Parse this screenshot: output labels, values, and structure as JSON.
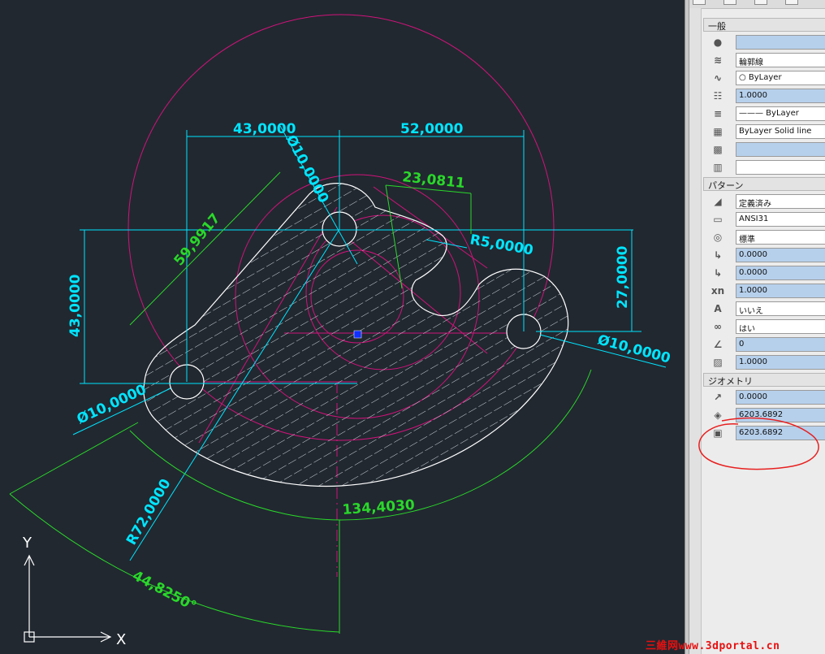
{
  "drawing": {
    "dims": {
      "dim_43_horiz": "43,0000",
      "dim_52_horiz": "52,0000",
      "dim_dia_top": "Ø10,0000",
      "dim_23": "23,0811",
      "dim_59": "59,9917",
      "dim_r5": "R5,0000",
      "dim_27": "27,0000",
      "dim_43_vert": "43,0000",
      "dim_dia_right": "Ø10,0000",
      "dim_dia_left": "Ø10,0000",
      "dim_r72": "R72,0000",
      "dim_134": "134,4030",
      "dim_angle": "44,8250°"
    },
    "ucs": {
      "y_label": "Y",
      "x_label": "X"
    },
    "colors": {
      "background": "#212830",
      "dimension": "#00e5ff",
      "dimension_green": "#2ad82a",
      "construction": "#d0137a",
      "outline": "#ffffff",
      "grip": "#1030ff"
    }
  },
  "panel": {
    "sections": {
      "general": "一般",
      "pattern": "パターン",
      "geometry": "ジオメトリ"
    },
    "general_rows": [
      {
        "icon": "color-icon",
        "value": "",
        "style": "blue"
      },
      {
        "icon": "layer-icon",
        "value": "輪郭線",
        "style": "white"
      },
      {
        "icon": "linetype-icon",
        "value": "○ ByLayer",
        "style": "white"
      },
      {
        "icon": "linetype-scale-icon",
        "value": "1.0000",
        "style": "blue"
      },
      {
        "icon": "lineweight-icon",
        "value": "——— ByLayer",
        "style": "white"
      },
      {
        "icon": "plot-style-icon",
        "value": "ByLayer     Solid line",
        "style": "white"
      },
      {
        "icon": "transparency-icon",
        "value": "",
        "style": "blue"
      },
      {
        "icon": "hyperlink-icon",
        "value": "",
        "style": "white"
      }
    ],
    "pattern_rows": [
      {
        "icon": "hatch-type-icon",
        "value": "定義済み",
        "style": "white"
      },
      {
        "icon": "pattern-name-icon",
        "value": "ANSI31",
        "style": "white"
      },
      {
        "icon": "annotative-scale-icon",
        "value": "標準",
        "style": "white"
      },
      {
        "icon": "origin-x-icon",
        "value": "0.0000",
        "style": "blue"
      },
      {
        "icon": "origin-y-icon",
        "value": "0.0000",
        "style": "blue"
      },
      {
        "icon": "scale-xn-icon",
        "value": "1.0000",
        "style": "blue"
      },
      {
        "icon": "annotative-a-icon",
        "value": "いいえ",
        "style": "white"
      },
      {
        "icon": "associative-icon",
        "value": "はい",
        "style": "white"
      },
      {
        "icon": "angle-icon",
        "value": "0",
        "style": "blue"
      },
      {
        "icon": "spacing-icon",
        "value": "1.0000",
        "style": "blue"
      }
    ],
    "geometry_rows": [
      {
        "icon": "elevation-z-icon",
        "value": "0.0000",
        "style": "blue"
      },
      {
        "icon": "area-icon",
        "value": "6203.6892",
        "style": "blue"
      },
      {
        "icon": "area-total-icon",
        "value": "6203.6892",
        "style": "blue"
      }
    ]
  },
  "watermark": "三維网www.3dportal.cn"
}
